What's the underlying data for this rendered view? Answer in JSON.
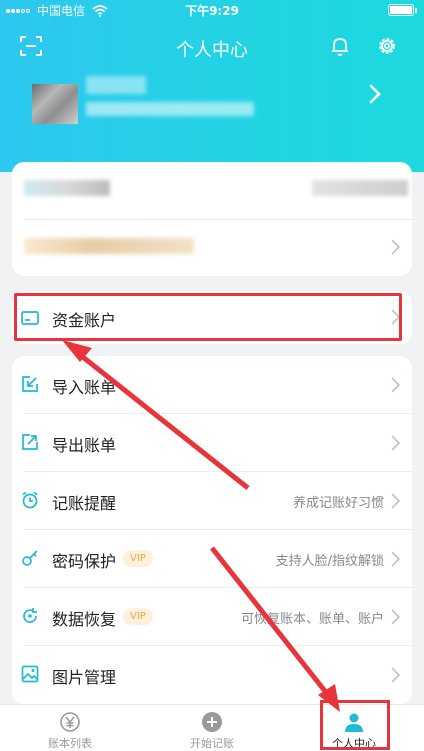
{
  "status_bar": {
    "carrier": "中国电信",
    "time": "下午9:29"
  },
  "header": {
    "title": "个人中心"
  },
  "menu": {
    "account": {
      "label": "资金账户"
    },
    "items": [
      {
        "label": "导入账单",
        "vip": "",
        "right": ""
      },
      {
        "label": "导出账单",
        "vip": "",
        "right": ""
      },
      {
        "label": "记账提醒",
        "vip": "",
        "right": "养成记账好习惯"
      },
      {
        "label": "密码保护",
        "vip": "VIP",
        "right": "支持人脸/指纹解锁"
      },
      {
        "label": "数据恢复",
        "vip": "VIP",
        "right": "可恢复账本、账单、账户"
      },
      {
        "label": "图片管理",
        "vip": "",
        "right": ""
      }
    ]
  },
  "tabbar": {
    "tabs": [
      {
        "label": "账本列表",
        "icon": "ledger-icon"
      },
      {
        "label": "开始记账",
        "icon": "plus-circle-icon"
      },
      {
        "label": "个人中心",
        "icon": "user-icon"
      }
    ],
    "active": 2
  },
  "colors": {
    "accent": "#22d3e3",
    "annotation": "#e8343b",
    "vip": "#e7a93c"
  }
}
